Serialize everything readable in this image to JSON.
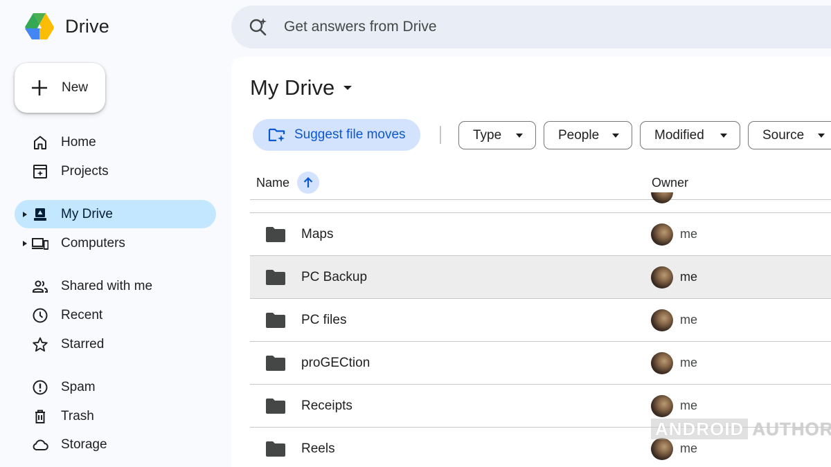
{
  "app": {
    "title": "Drive"
  },
  "search": {
    "placeholder": "Get answers from Drive"
  },
  "new_button": {
    "label": "New"
  },
  "sidebar": {
    "items": [
      {
        "label": "Home",
        "icon": "home-icon"
      },
      {
        "label": "Projects",
        "icon": "projects-icon"
      },
      {
        "label": "My Drive",
        "icon": "my-drive-icon",
        "active": true
      },
      {
        "label": "Computers",
        "icon": "computers-icon"
      },
      {
        "label": "Shared with me",
        "icon": "shared-icon"
      },
      {
        "label": "Recent",
        "icon": "clock-icon"
      },
      {
        "label": "Starred",
        "icon": "star-icon"
      },
      {
        "label": "Spam",
        "icon": "spam-icon"
      },
      {
        "label": "Trash",
        "icon": "trash-icon"
      },
      {
        "label": "Storage",
        "icon": "cloud-icon"
      }
    ]
  },
  "main": {
    "title": "My Drive",
    "suggest_label": "Suggest file moves",
    "filters": [
      "Type",
      "People",
      "Modified",
      "Source"
    ],
    "columns": {
      "name": "Name",
      "owner": "Owner"
    },
    "rows": [
      {
        "name": "Maps",
        "owner": "me"
      },
      {
        "name": "PC Backup",
        "owner": "me",
        "highlighted": true
      },
      {
        "name": "PC files",
        "owner": "me"
      },
      {
        "name": "proGECtion",
        "owner": "me"
      },
      {
        "name": "Receipts",
        "owner": "me"
      },
      {
        "name": "Reels",
        "owner": "me"
      }
    ]
  },
  "watermark": {
    "part1": "ANDROID",
    "part2": "AUTHORITY"
  },
  "colors": {
    "accent": "#0b57d0",
    "active_nav": "#c2e7ff",
    "suggest_bg": "#d3e3fd",
    "background": "#f8fafd",
    "search_bg": "#e9eef6"
  }
}
